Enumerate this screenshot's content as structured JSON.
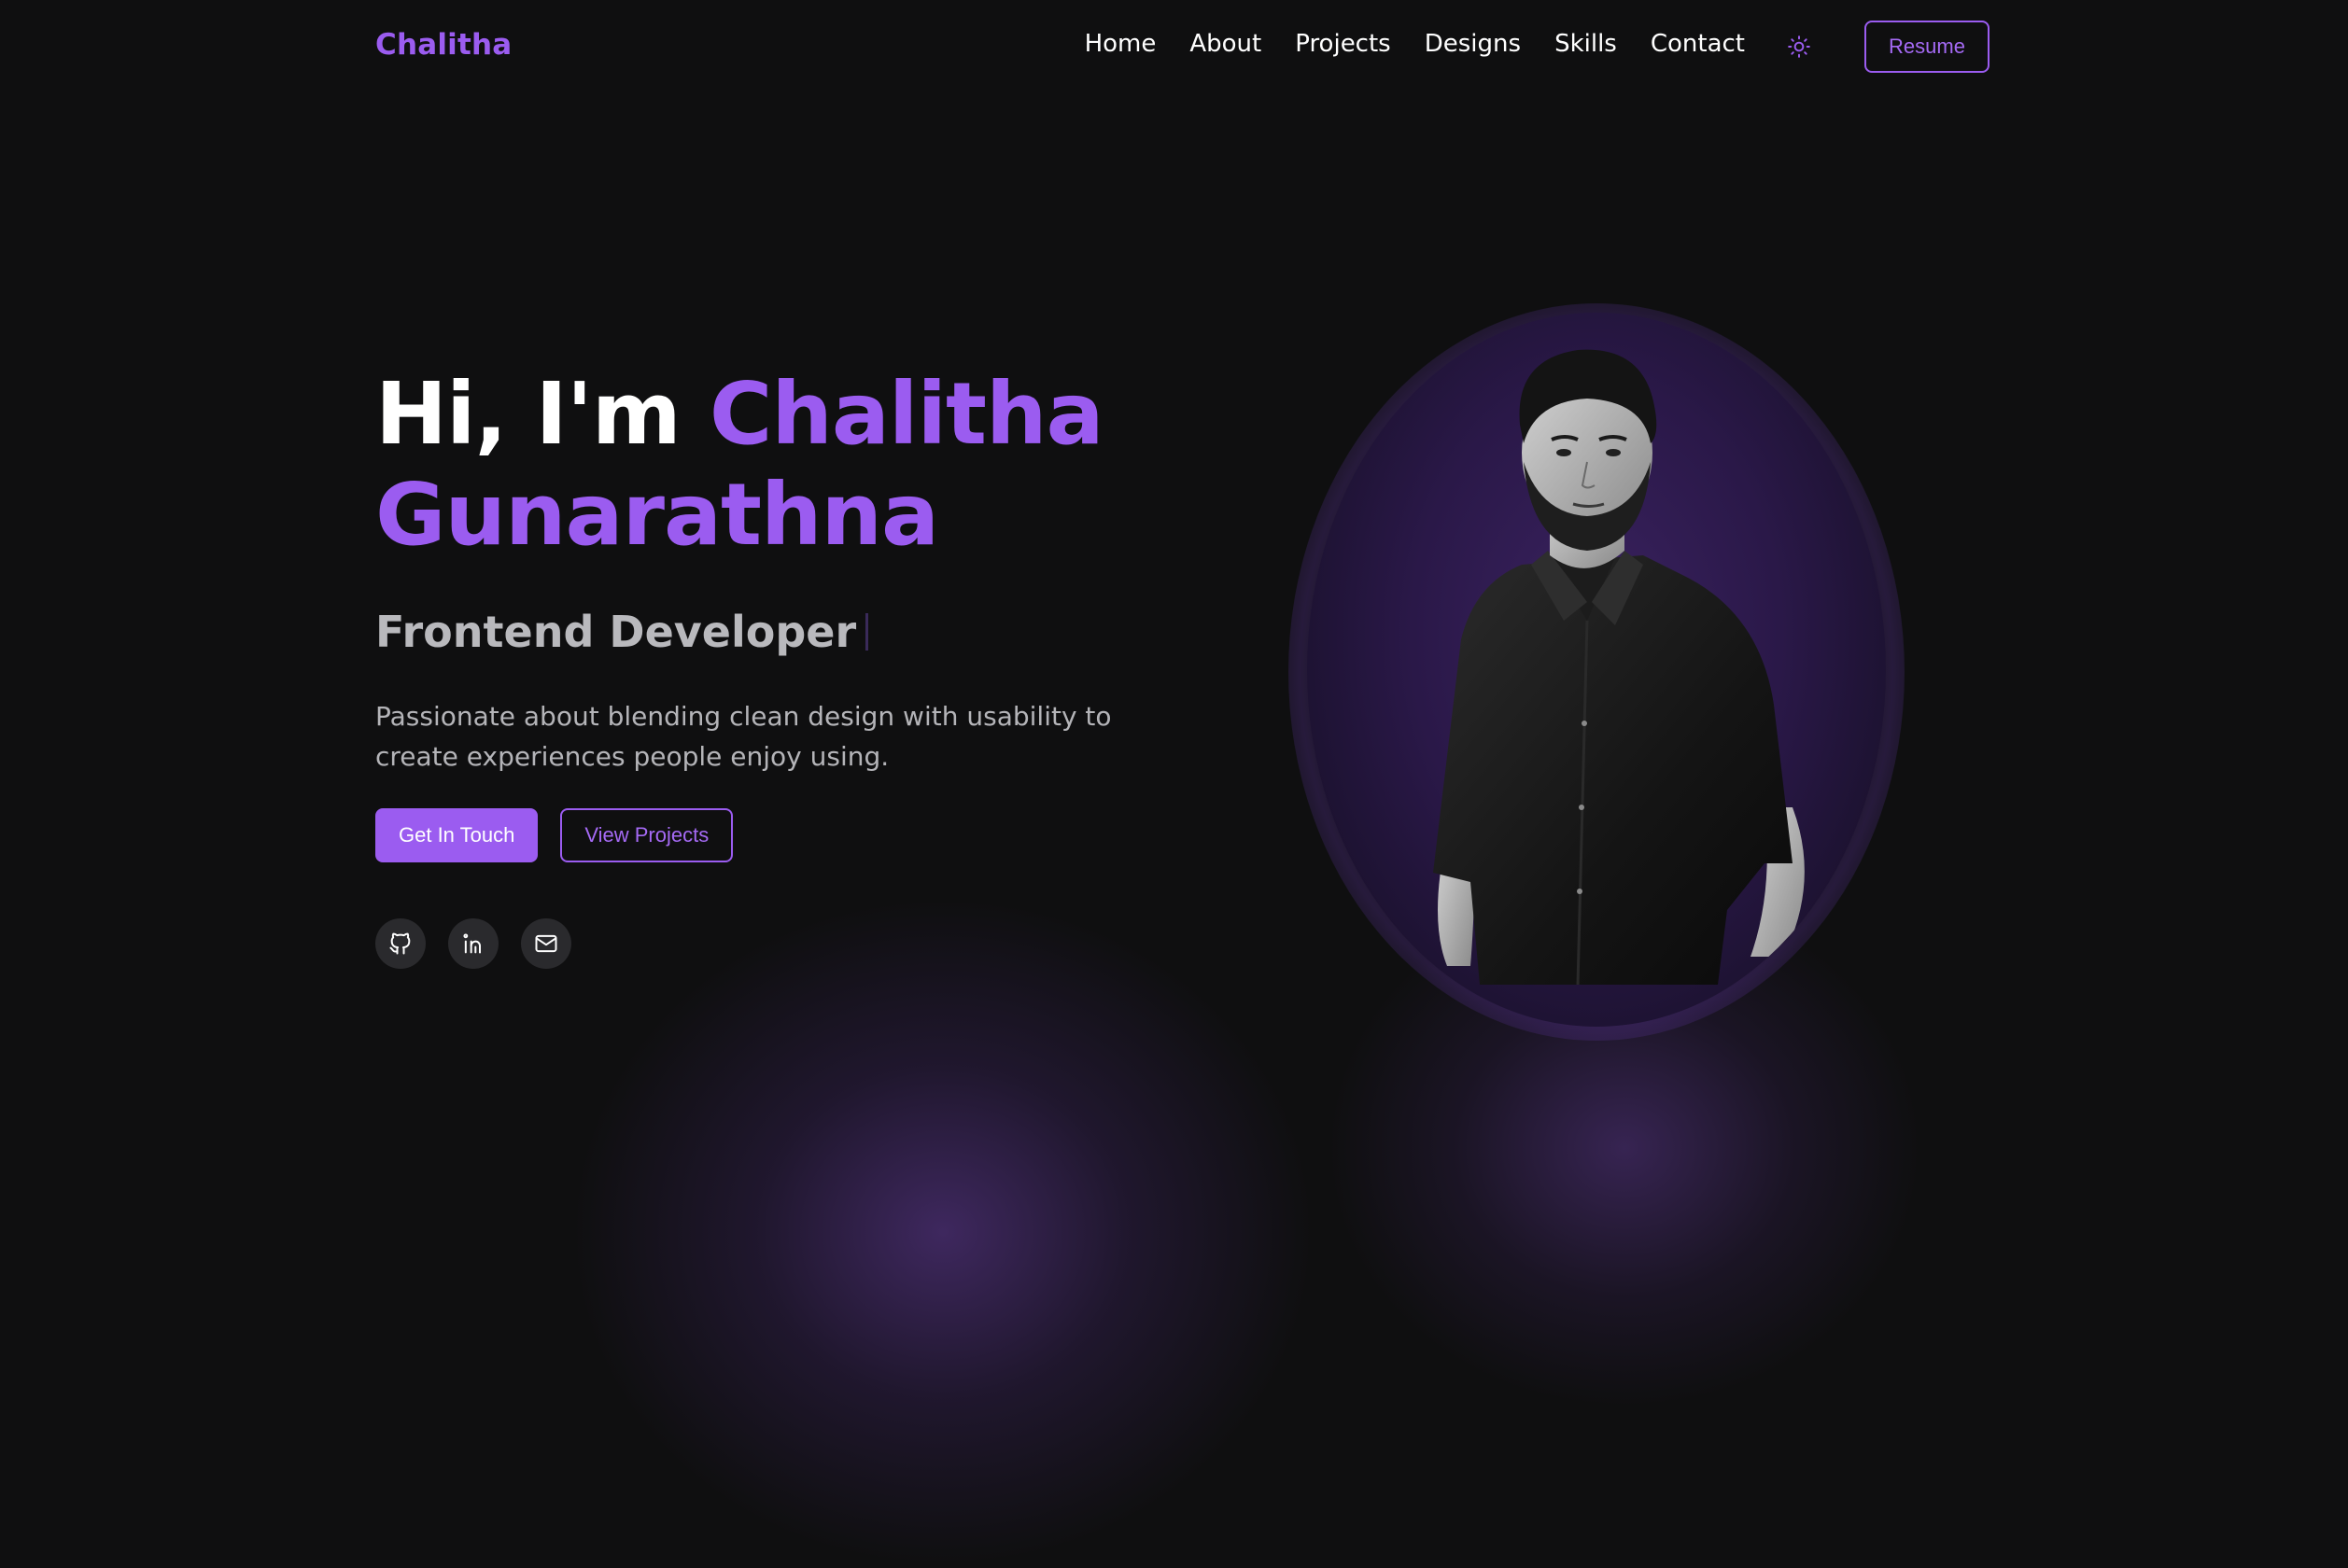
{
  "nav": {
    "logo": "Chalitha",
    "links": [
      "Home",
      "About",
      "Projects",
      "Designs",
      "Skills",
      "Contact"
    ],
    "theme_icon": "sun-icon",
    "resume_label": "Resume"
  },
  "hero": {
    "greeting": "Hi, I'm",
    "first_name": "Chalitha",
    "last_name": "Gunarathna",
    "role": "Frontend Developer",
    "tagline": "Passionate about blending clean design with usability to create experiences people enjoy using.",
    "primary_cta": "Get In Touch",
    "secondary_cta": "View Projects",
    "social": [
      "github-icon",
      "linkedin-icon",
      "mail-icon"
    ]
  },
  "colors": {
    "background": "#0f0f10",
    "accent": "#9b5cf0",
    "text": "#ffffff",
    "muted": "#b4b4b8"
  }
}
